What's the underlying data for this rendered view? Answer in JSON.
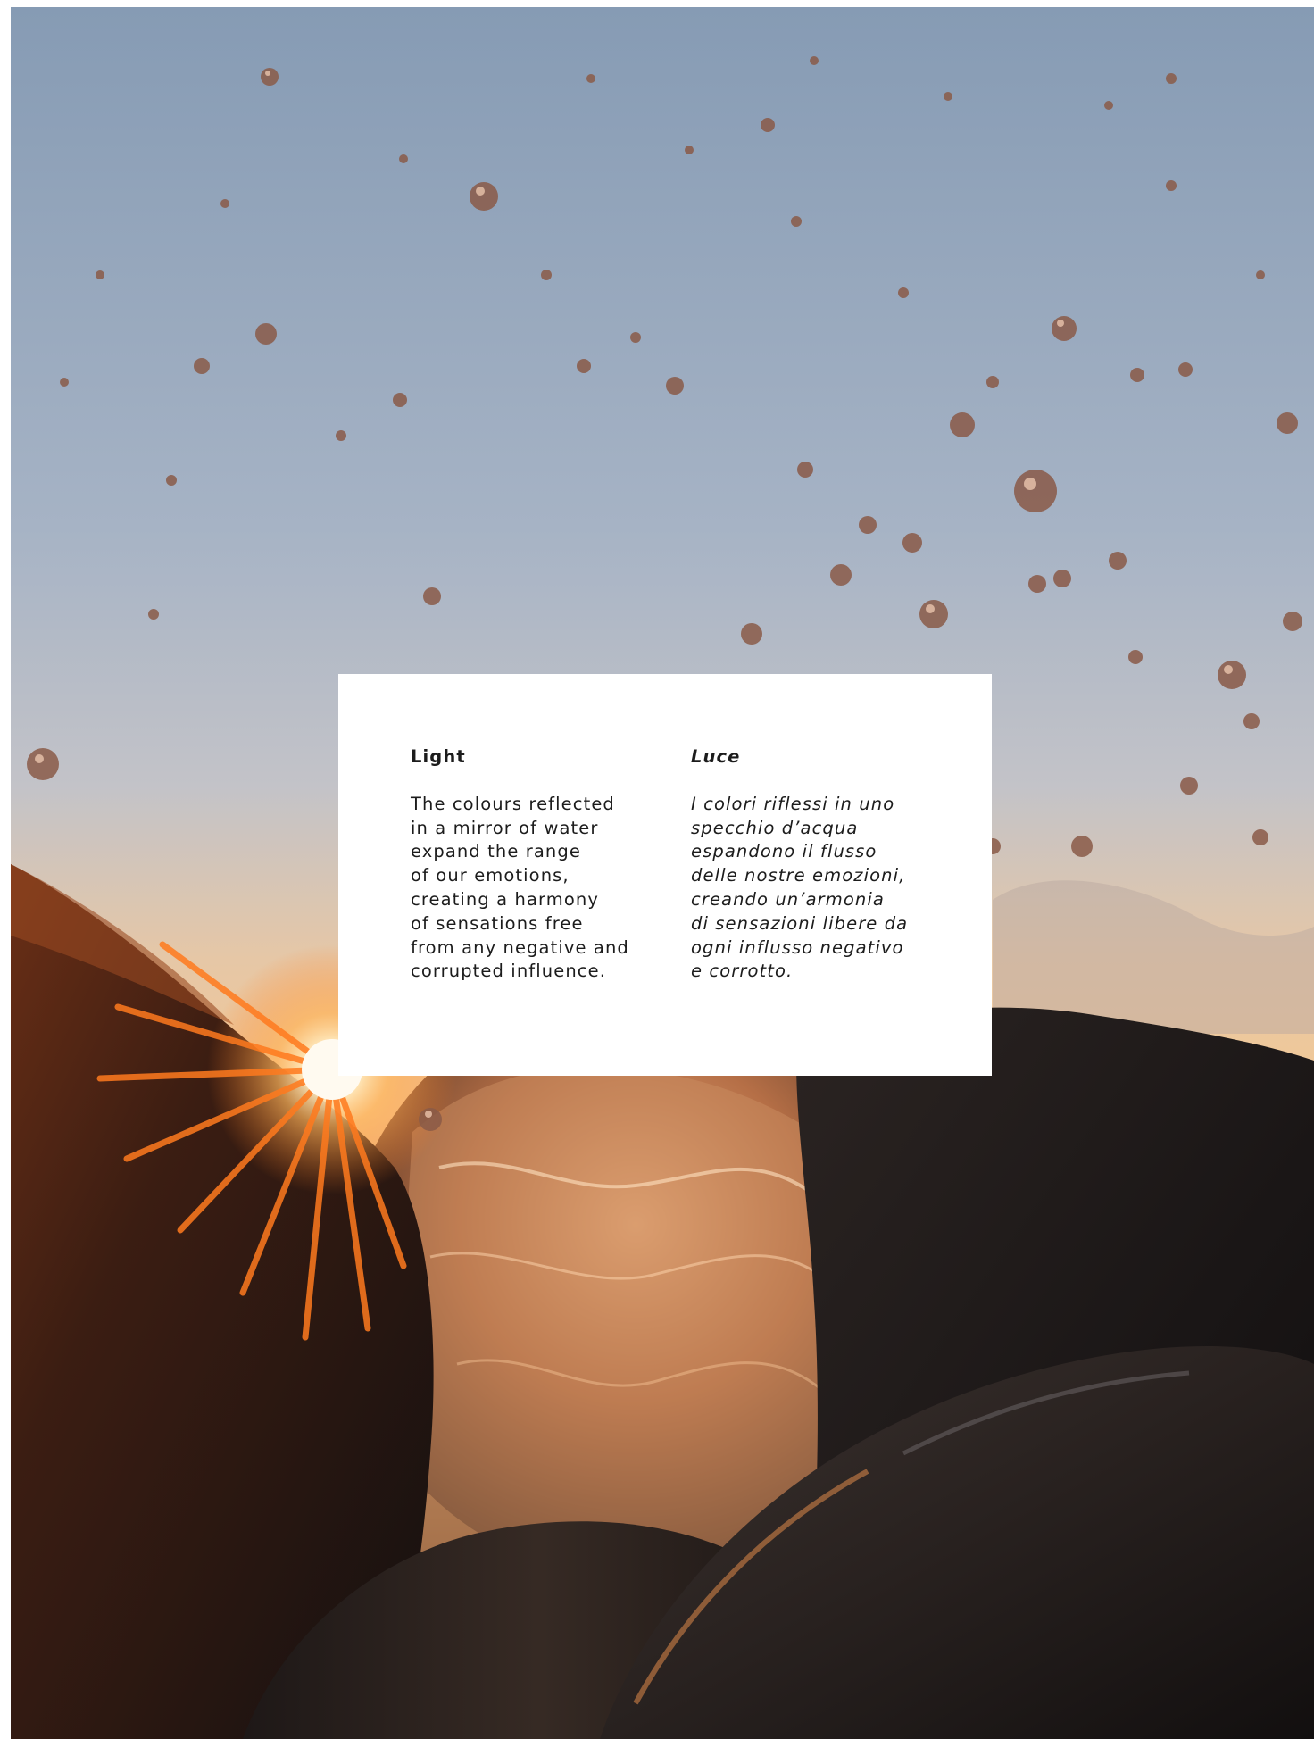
{
  "photo": {
    "subject": "water splash against rocks at sunset",
    "colors": {
      "sky_top": "#8a9db5",
      "sky_mid": "#b3bdcb",
      "horizon": "#f2c48f",
      "sun": "#fff6dc",
      "sun_rays": "#ff7a1e",
      "rock_dark": "#1f1a18",
      "rock_warm": "#5a2a14",
      "water_glow": "#d9885a"
    }
  },
  "card": {
    "english": {
      "heading": "Light",
      "lines": [
        "The colours reflected",
        "in a mirror of water",
        "expand the range",
        "of our emotions,",
        "creating a harmony",
        "of sensations free",
        "from any negative and",
        "corrupted influence."
      ]
    },
    "italian": {
      "heading": "Luce",
      "lines": [
        "I colori riflessi in uno",
        "specchio d’acqua",
        "espandono il flusso",
        "delle nostre emozioni,",
        "creando un’armonia",
        "di sensazioni libere da",
        "ogni influsso negativo",
        "e corrotto."
      ]
    }
  }
}
